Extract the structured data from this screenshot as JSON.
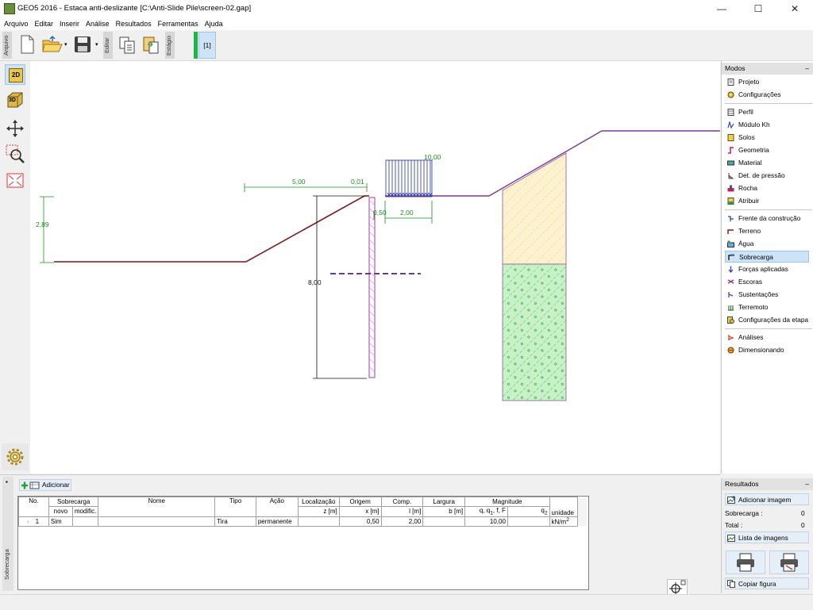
{
  "window": {
    "title": "GEO5 2016 - Estaca anti-deslizante [C:\\Anti-Slide Pile\\screen-02.gap]",
    "minimize": "—",
    "maximize": "☐",
    "close": "✕"
  },
  "menu": [
    "Arquivo",
    "Editar",
    "Inserir",
    "Análise",
    "Resultados",
    "Ferramentas",
    "Ajuda"
  ],
  "toolbar": {
    "file_tab": "Arquivo",
    "edit_tab": "Editar",
    "stage_tab": "Estágio",
    "stage_label": "[1]"
  },
  "leftbar": {
    "btn_2d": "2D",
    "btn_3d": "3D"
  },
  "drawing": {
    "dim_500": "5,00",
    "dim_001": "0,01",
    "dim_1000": "10,00",
    "dim_050": "0,50",
    "dim_200": "2,00",
    "dim_289": "2,89",
    "dim_800": "8,00"
  },
  "modes": {
    "header": "Modos",
    "collapse": "–",
    "group1": [
      "Projeto",
      "Configurações"
    ],
    "group2": [
      "Perfil",
      "Módulo Kh",
      "Solos",
      "Geometria",
      "Material",
      "Det. de pressão",
      "Rocha",
      "Atribuir"
    ],
    "group3": [
      "Frente da construção",
      "Terreno",
      "Água",
      "Sobrecarga",
      "Forças aplicadas",
      "Escoras",
      "Sustentações",
      "Terremoto",
      "Configurações da etapa"
    ],
    "group4": [
      "Análises",
      "Dimensionando"
    ],
    "selected": "Sobrecarga"
  },
  "bottom": {
    "side_label": "Sobrecarga",
    "add_button": "Adicionar",
    "headers": {
      "no": "No.",
      "sobrecarga": "Sobrecarga",
      "novo": "novo",
      "modific": "modific.",
      "nome": "Nome",
      "tipo": "Tipo",
      "acao": "Ação",
      "localizacao": "Localização",
      "localizacao_u": "z [m]",
      "origem": "Origem",
      "origem_u": "x [m]",
      "comp": "Comp.",
      "comp_u": "l [m]",
      "largura": "Largura",
      "largura_u": "b [m]",
      "magnitude": "Magnitude",
      "mag_q": "q, q",
      "mag_f": ", f, F",
      "mag_q2": "q",
      "unidade": "unidade"
    },
    "row": {
      "expand": "›",
      "num": "1",
      "novo": "Sim",
      "modific": "",
      "nome": "",
      "tipo": "Tira",
      "acao": "permanente",
      "z": "",
      "x": "0,50",
      "l": "2,00",
      "b": "",
      "q": "10,00",
      "q2": "",
      "unidade": "kN/m"
    }
  },
  "results": {
    "header": "Resultados",
    "collapse": "–",
    "add_image": "Adicionar imagem",
    "sobrecarga_label": "Sobrecarga :",
    "sobrecarga_value": "0",
    "total_label": "Total :",
    "total_value": "0",
    "image_list": "Lista de imagens",
    "copy_figure": "Copiar figura"
  },
  "colors": {
    "selected": "#cde3f7",
    "terrain": "#7a1a1a",
    "dimension": "#1e8c1e",
    "load": "#2233aa",
    "pile": "#a43aa4"
  }
}
